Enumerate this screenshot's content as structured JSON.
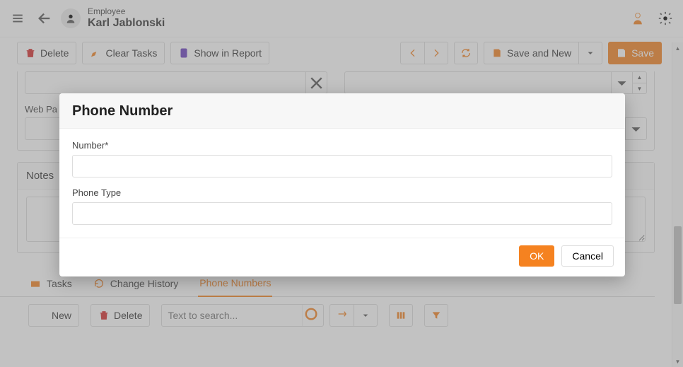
{
  "header": {
    "type_label": "Employee",
    "name": "Karl Jablonski"
  },
  "actions": {
    "delete": "Delete",
    "clear_tasks": "Clear Tasks",
    "show_in_report": "Show in Report",
    "save_and_new": "Save and New",
    "save": "Save"
  },
  "form": {
    "field_a_label": "",
    "field_b_label": "",
    "web_page_label": "Web Pa",
    "web_page_value": ""
  },
  "notes": {
    "header": "Notes",
    "value": ""
  },
  "tabs": {
    "tasks": "Tasks",
    "change_history": "Change History",
    "phone_numbers": "Phone Numbers"
  },
  "subbar": {
    "new_label": "New",
    "delete_label": "Delete",
    "search_placeholder": "Text to search..."
  },
  "modal": {
    "title": "Phone Number",
    "number_label": "Number*",
    "number_value": "",
    "type_label": "Phone Type",
    "type_value": "",
    "ok": "OK",
    "cancel": "Cancel"
  }
}
